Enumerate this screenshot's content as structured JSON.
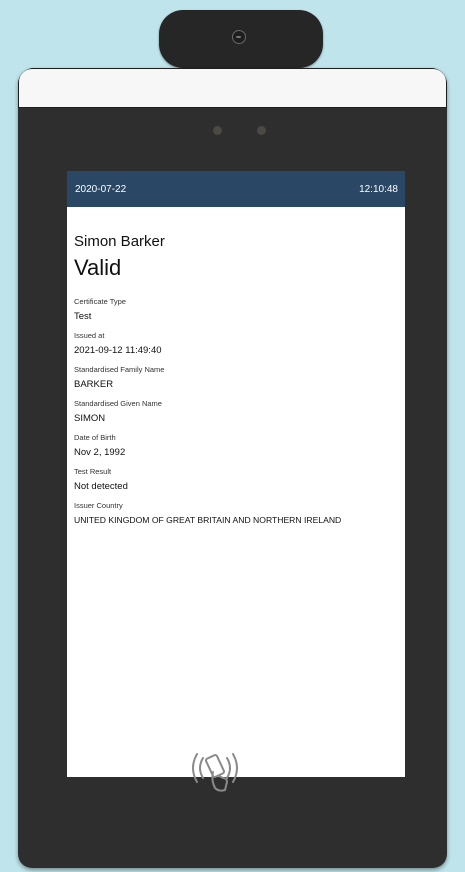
{
  "status_bar": {
    "date": "2020-07-22",
    "time": "12:10:48"
  },
  "certificate": {
    "person_name": "Simon Barker",
    "status": "Valid",
    "fields": [
      {
        "label": "Certificate Type",
        "value": "Test"
      },
      {
        "label": "Issued at",
        "value": "2021-09-12 11:49:40"
      },
      {
        "label": "Standardised Family Name",
        "value": "BARKER"
      },
      {
        "label": "Standardised Given Name",
        "value": "SIMON"
      },
      {
        "label": "Date of Birth",
        "value": "Nov 2, 1992"
      },
      {
        "label": "Test Result",
        "value": "Not detected"
      },
      {
        "label": "Issuer Country",
        "value": "UNITED KINGDOM OF GREAT BRITAIN AND NORTHERN IRELAND"
      }
    ]
  },
  "icons": {
    "camera": "camera-icon",
    "nfc": "nfc-reader-icon"
  },
  "colors": {
    "background": "#bfe4ec",
    "device_body": "#2e2e2e",
    "status_bar": "#2a4866"
  }
}
